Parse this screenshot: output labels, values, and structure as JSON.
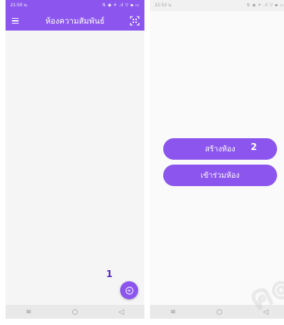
{
  "left_screen": {
    "status": {
      "time": "21:50 น.",
      "icons": "⇅ ◉ ✈ .ıl ▽ ▪ ▭"
    },
    "appbar": {
      "title": "ห้องความสัมพันธ์",
      "menu_icon": "menu-icon",
      "scan_icon": "qr-scan-icon"
    },
    "fab": {
      "icon": "plus-circle-icon"
    },
    "step_label": "1"
  },
  "right_screen": {
    "status": {
      "time": "21:52 น.",
      "icons": "⇅ ◉ ✈ .ıl ▽ ▪ ▭"
    },
    "create_room_label": "สร้างห้อง",
    "join_room_label": "เข้าร่วมห้อง",
    "step_label": "2"
  },
  "navbar": {
    "menu_glyph": "≡",
    "home_glyph": "○",
    "back_glyph": "◁"
  },
  "watermark_text": "ค๏",
  "colors": {
    "accent": "#8c56ee",
    "marker": "#5326c7"
  }
}
